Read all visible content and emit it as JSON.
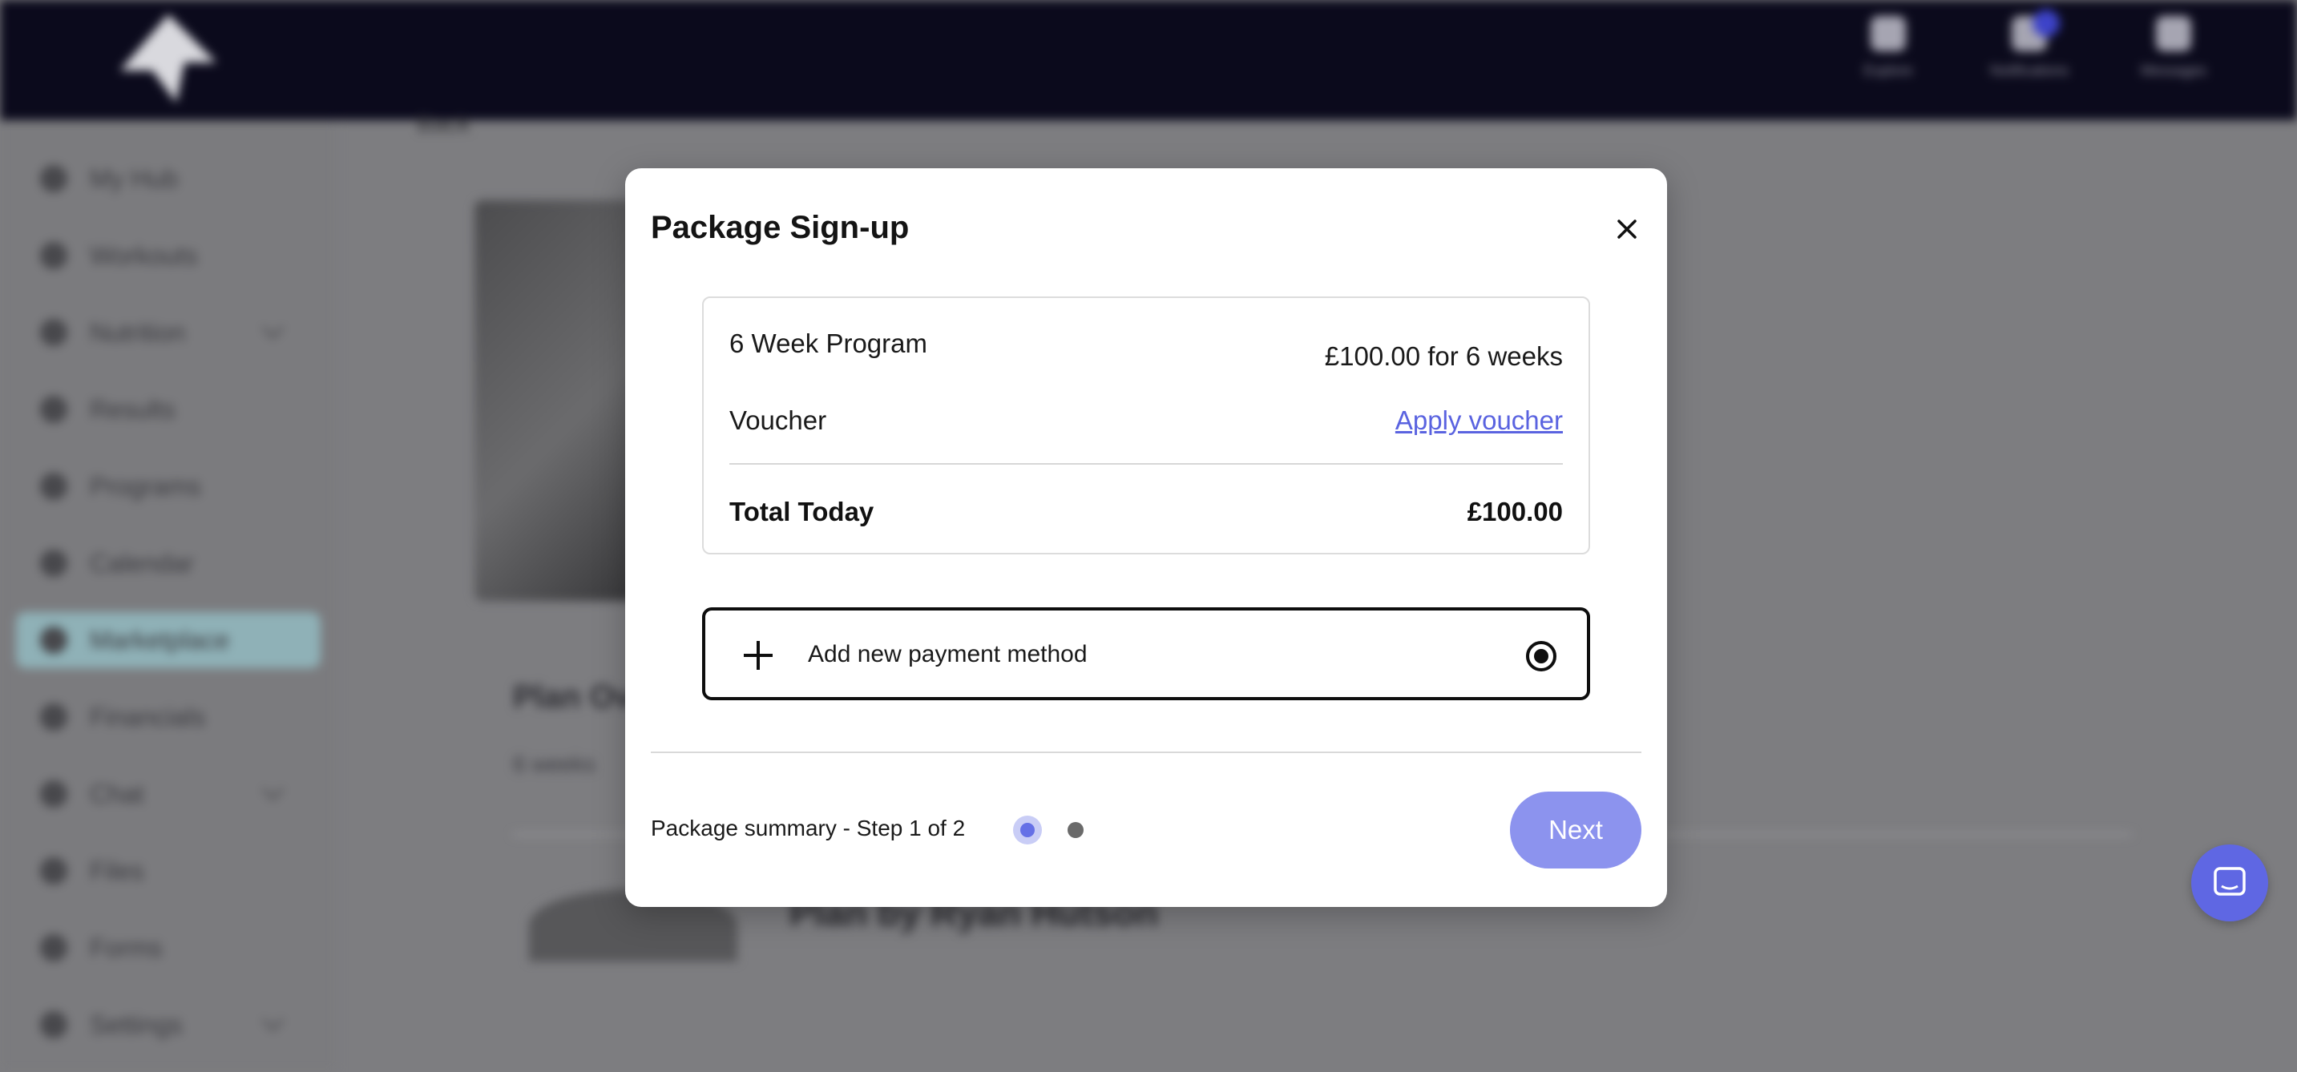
{
  "background": {
    "topbar": {
      "icons": [
        {
          "name": "profile-icon",
          "label": "Explore"
        },
        {
          "name": "notifications-icon",
          "label": "Notifications"
        },
        {
          "name": "messages-icon",
          "label": "Messages"
        }
      ]
    },
    "sidebar": {
      "items": [
        {
          "label": "My Hub"
        },
        {
          "label": "Workouts"
        },
        {
          "label": "Nutrition"
        },
        {
          "label": "Results"
        },
        {
          "label": "Programs"
        },
        {
          "label": "Calendar"
        },
        {
          "label": "Marketplace"
        },
        {
          "label": "Financials"
        },
        {
          "label": "Chat"
        },
        {
          "label": "Files"
        },
        {
          "label": "Forms"
        },
        {
          "label": "Settings"
        }
      ]
    },
    "main": {
      "back_label": "Back",
      "title": "Plan Overview",
      "subtitle": "6 weeks",
      "author": "Plan by Ryan Hutson"
    }
  },
  "modal": {
    "title": "Package Sign-up",
    "summary": {
      "program_name": "6 Week Program",
      "program_price": "£100.00 for 6 weeks",
      "voucher_label": "Voucher",
      "voucher_link": "Apply voucher",
      "total_label": "Total Today",
      "total_value": "£100.00"
    },
    "payment": {
      "add_label": "Add new payment method",
      "selected": true
    },
    "footer": {
      "step_text": "Package summary - Step 1 of 2",
      "current_step": 1,
      "total_steps": 2,
      "next_label": "Next"
    }
  },
  "colors": {
    "accent": "#6570e6",
    "next_button": "#8c93ee",
    "link": "#5a63e0",
    "topbar": "#0b0a1c"
  }
}
